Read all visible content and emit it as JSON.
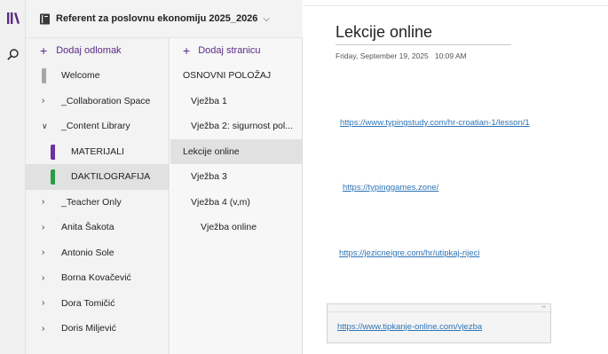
{
  "notebook": {
    "title": "Referent za poslovnu ekonomiju 2025_2026"
  },
  "sections": {
    "add_label": "Dodaj odlomak",
    "items": [
      {
        "label": "Welcome",
        "tab_color": "#a6a6a6"
      },
      {
        "label": "_Collaboration Space"
      },
      {
        "label": "_Content Library"
      },
      {
        "label": "MATERIJALI",
        "tab_color": "#7030a0"
      },
      {
        "label": "DAKTILOGRAFIJA",
        "tab_color": "#2e9b46"
      },
      {
        "label": "_Teacher Only"
      },
      {
        "label": "Anita Šakota"
      },
      {
        "label": "Antonio Sole"
      },
      {
        "label": "Borna Kovačević"
      },
      {
        "label": "Dora Tomičić"
      },
      {
        "label": "Doris Miljević"
      }
    ]
  },
  "pages": {
    "add_label": "Dodaj stranicu",
    "items": [
      {
        "label": "OSNOVNI POLOŽAJ"
      },
      {
        "label": "Vježba 1"
      },
      {
        "label": "Vježba 2: sigurnost pol..."
      },
      {
        "label": "Lekcije online"
      },
      {
        "label": "Vježba 3"
      },
      {
        "label": "Vježba 4 (v,m)"
      },
      {
        "label": "Vježba online"
      }
    ]
  },
  "page": {
    "title": "Lekcije online",
    "date": "Friday, September 19, 2025",
    "time": "10:09 AM",
    "links": [
      "https://www.typingstudy.com/hr-croatian-1/lesson/1",
      "https://typinggames.zone/",
      "https://jezicneigre.com/hr/utipkaj-rijeci",
      "https://www.tipkanje-online.com/vjezba"
    ]
  },
  "icons": {
    "rail_top": "notebooks-icon",
    "rail_search": "search-icon",
    "notebook": "notebook-icon",
    "expand": "chevron-down-icon"
  },
  "colors": {
    "accent": "#5b2a86",
    "link": "#2e74b5"
  }
}
